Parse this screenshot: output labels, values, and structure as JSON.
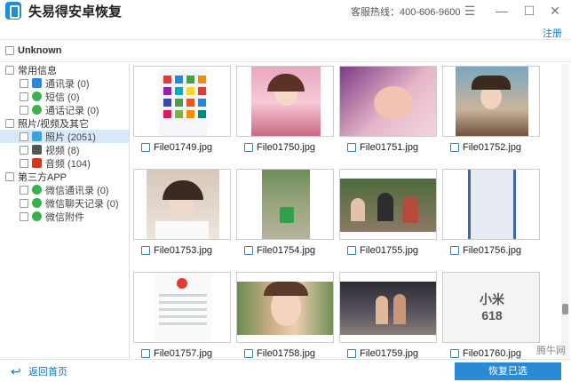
{
  "titlebar": {
    "title": "失易得安卓恢复",
    "hotline": "客服热线：400-606-9600",
    "menu_icon": "menu-icon",
    "minimize_icon": "minimize-icon",
    "maximize_icon": "maximize-icon",
    "close_icon": "close-icon"
  },
  "register_label": "注册",
  "unknown_label": "Unknown",
  "sidebar": {
    "groups": [
      {
        "label": "常用信息",
        "children": [
          {
            "label": "通讯录 (0)",
            "icon": "contacts-icon"
          },
          {
            "label": "短信 (0)",
            "icon": "sms-icon"
          },
          {
            "label": "通话记录 (0)",
            "icon": "call-log-icon"
          }
        ]
      },
      {
        "label": "照片/视频及其它",
        "children": [
          {
            "label": "照片 (2051)",
            "icon": "photo-icon"
          },
          {
            "label": "视频 (8)",
            "icon": "video-icon"
          },
          {
            "label": "音频 (104)",
            "icon": "audio-icon"
          }
        ]
      },
      {
        "label": "第三方APP",
        "children": [
          {
            "label": "微信通讯录 (0)",
            "icon": "wechat-icon"
          },
          {
            "label": "微信聊天记录 (0)",
            "icon": "wechat-icon"
          },
          {
            "label": "微信附件",
            "icon": "wechat-icon"
          }
        ]
      }
    ]
  },
  "files": [
    "File01749.jpg",
    "File01750.jpg",
    "File01751.jpg",
    "File01752.jpg",
    "File01753.jpg",
    "File01754.jpg",
    "File01755.jpg",
    "File01756.jpg",
    "File01757.jpg",
    "File01758.jpg",
    "File01759.jpg",
    "File01760.jpg"
  ],
  "thumb_text": {
    "mi": "小米",
    "num": "618"
  },
  "footer": {
    "back_label": "返回首页",
    "recover_label": "恢复已选"
  },
  "watermark": "腾牛网"
}
